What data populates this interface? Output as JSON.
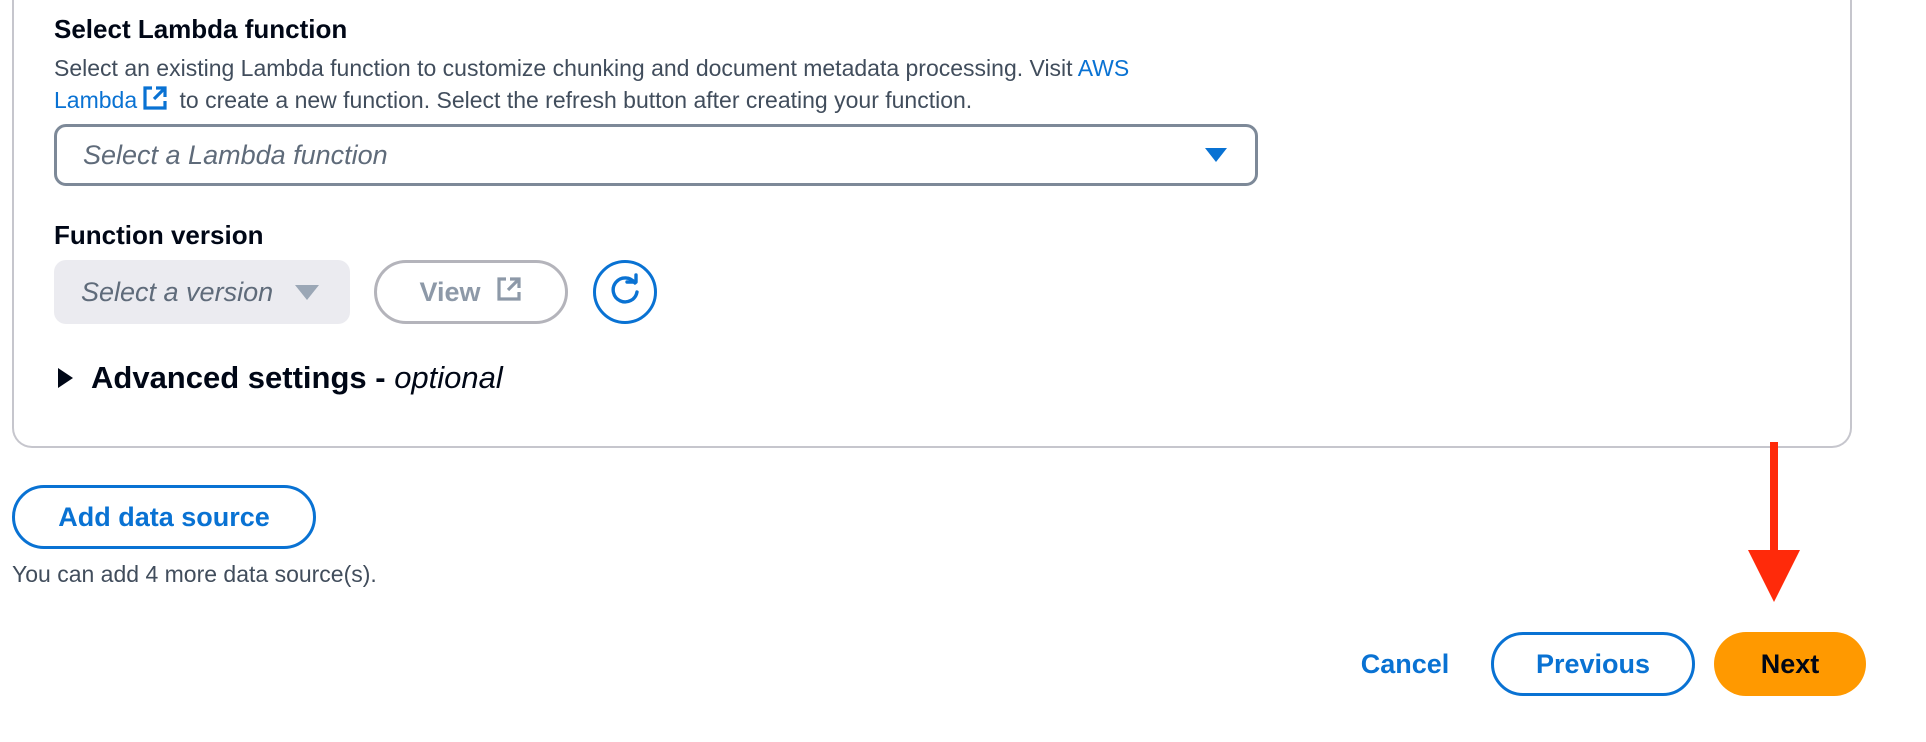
{
  "lambda_section": {
    "title": "Select Lambda function",
    "description_prefix": "Select an existing Lambda function to customize chunking and document metadata processing. Visit ",
    "link_aws": "AWS",
    "link_lambda": "Lambda",
    "description_suffix": " to create a new function. Select the refresh button after creating your function.",
    "select_placeholder": "Select a Lambda function"
  },
  "version_section": {
    "title": "Function version",
    "select_placeholder": "Select a version",
    "view_label": "View"
  },
  "advanced": {
    "label": "Advanced settings - ",
    "optional": "optional"
  },
  "add_source": {
    "button_label": "Add data source",
    "hint": "You can add 4 more data source(s)."
  },
  "footer": {
    "cancel_label": "Cancel",
    "previous_label": "Previous",
    "next_label": "Next"
  },
  "colors": {
    "link": "#0972d3",
    "primary": "#ff9900",
    "annotation_arrow": "#ff2a0a"
  },
  "icons": {
    "external_link": "external-link-icon",
    "refresh": "refresh-icon",
    "caret": "caret-down-icon",
    "expand": "caret-right-icon",
    "annotation": "red-arrow-icon"
  }
}
